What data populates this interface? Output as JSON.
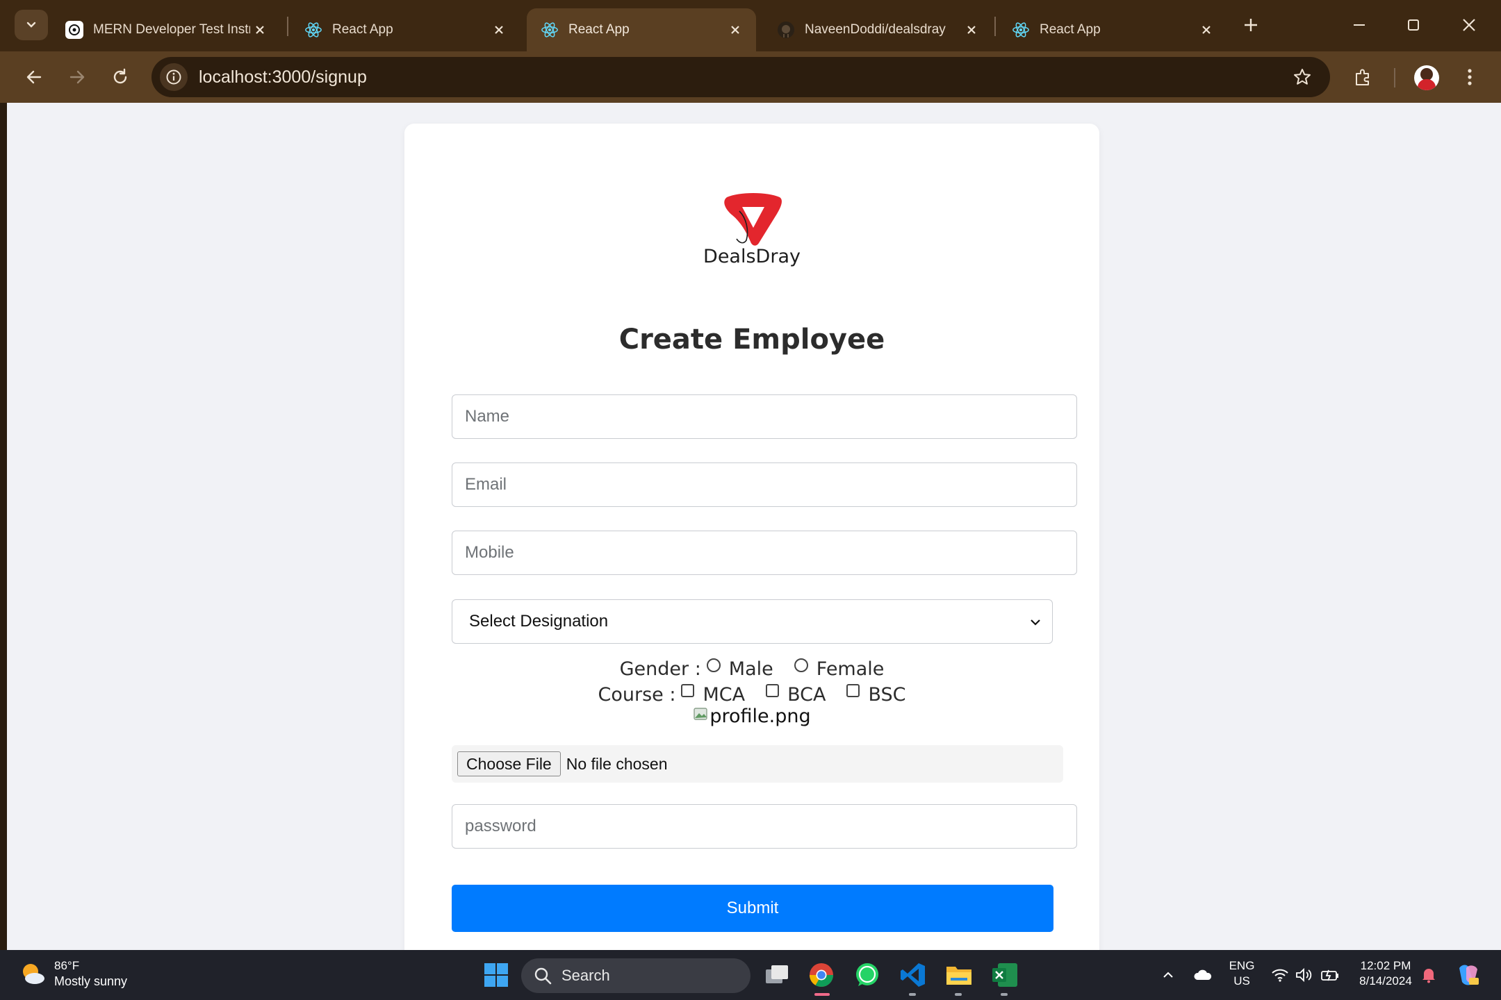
{
  "browser": {
    "tabs": [
      {
        "title": "MERN Developer Test Instruc",
        "icon": "chatgpt-icon",
        "active": false
      },
      {
        "title": "React App",
        "icon": "react-icon",
        "active": false
      },
      {
        "title": "React App",
        "icon": "react-icon",
        "active": true
      },
      {
        "title": "NaveenDoddi/dealsdray",
        "icon": "github-icon",
        "active": false
      },
      {
        "title": "React App",
        "icon": "react-icon",
        "active": false
      }
    ],
    "url": "localhost:3000/signup"
  },
  "form": {
    "logo_text": "DealsDray",
    "heading": "Create Employee",
    "name_placeholder": "Name",
    "email_placeholder": "Email",
    "mobile_placeholder": "Mobile",
    "designation_selected": "Select Designation",
    "gender_label": "Gender :",
    "gender_options": [
      "Male",
      "Female"
    ],
    "course_label": "Course :",
    "course_options": [
      "MCA",
      "BCA",
      "BSC"
    ],
    "image_alt": "profile.png",
    "file_button": "Choose File",
    "file_status": "No file chosen",
    "password_placeholder": "password",
    "submit_label": "Submit"
  },
  "taskbar": {
    "weather_temp": "86°F",
    "weather_condition": "Mostly sunny",
    "search_label": "Search",
    "lang_line1": "ENG",
    "lang_line2": "US",
    "time": "12:02 PM",
    "date": "8/14/2024"
  },
  "colors": {
    "accent": "#007bff",
    "logo_red": "#e3262d",
    "chrome_frame": "#3d2812"
  }
}
